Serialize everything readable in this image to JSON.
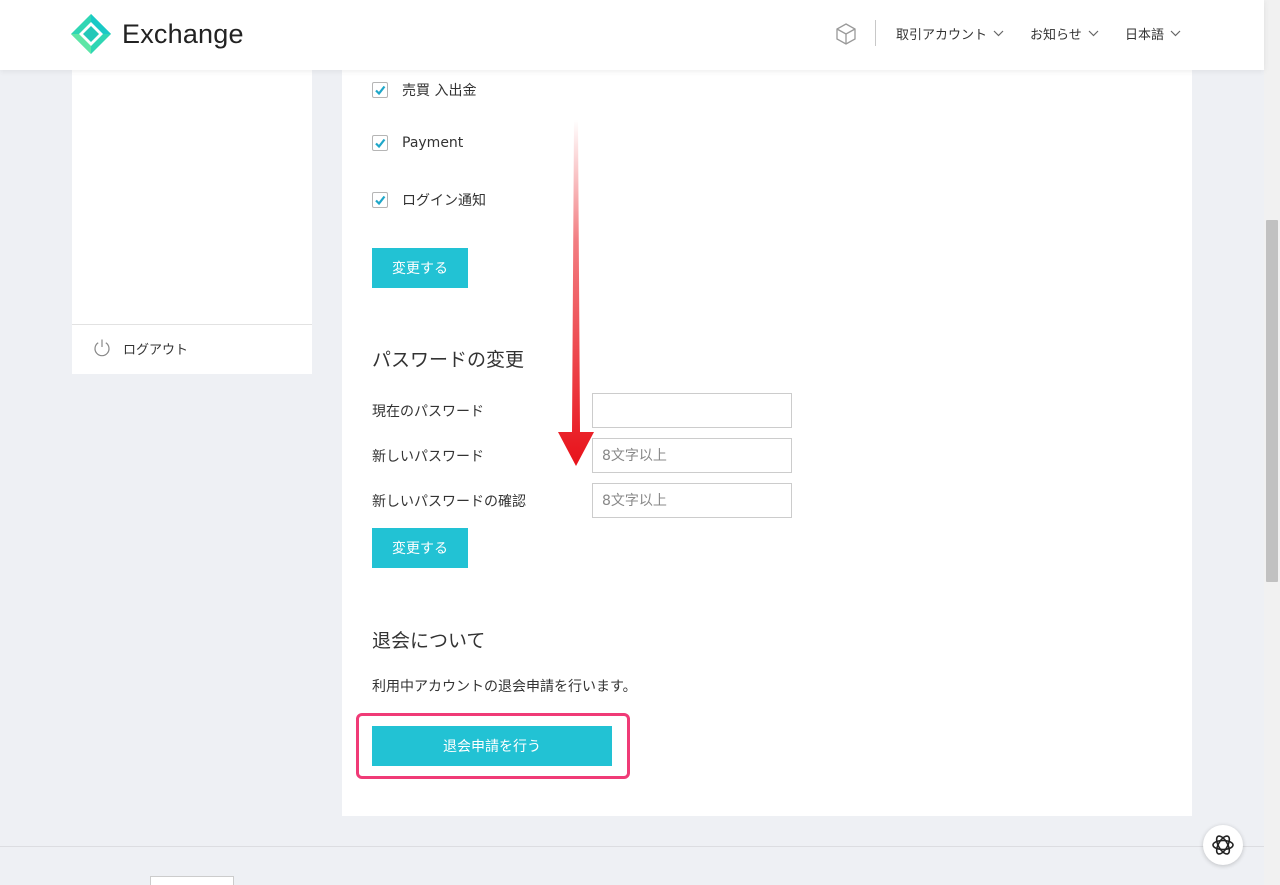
{
  "header": {
    "logo_text": "Exchange",
    "nav": {
      "account": "取引アカウント",
      "news": "お知らせ",
      "language": "日本語"
    }
  },
  "sidebar": {
    "logout_label": "ログアウト"
  },
  "notifications": {
    "items": [
      {
        "label": "売買 入出金",
        "checked": true
      },
      {
        "label": "Payment",
        "checked": true
      },
      {
        "label": "ログイン通知",
        "checked": true
      }
    ],
    "submit_label": "変更する"
  },
  "password": {
    "title": "パスワードの変更",
    "current_label": "現在のパスワード",
    "current_value": "",
    "new_label": "新しいパスワード",
    "new_placeholder": "8文字以上",
    "confirm_label": "新しいパスワードの確認",
    "confirm_placeholder": "8文字以上",
    "submit_label": "変更する"
  },
  "withdrawal": {
    "title": "退会について",
    "description": "利用中アカウントの退会申請を行います。",
    "button_label": "退会申請を行う"
  },
  "colors": {
    "accent": "#22c2d4",
    "highlight": "#f03b77",
    "arrow": "#e8121a"
  }
}
